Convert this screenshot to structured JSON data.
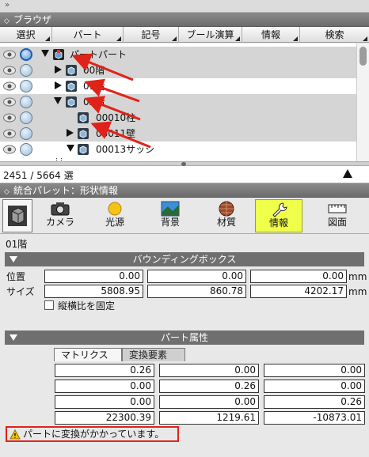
{
  "top_strip": "»",
  "browser": {
    "title": "ブラウザ",
    "menu": [
      "選択",
      "パート",
      "記号",
      "ブール演算",
      "情報",
      "検索"
    ],
    "tree": [
      {
        "label": "パートパート",
        "expanded": true
      },
      {
        "label": "00階",
        "expanded": false
      },
      {
        "label": "01階",
        "expanded": false
      },
      {
        "label": "02階",
        "expanded": true
      },
      {
        "label": "00010柱"
      },
      {
        "label": "00011壁",
        "expanded": false
      },
      {
        "label": "00013サッシ",
        "expanded": true
      }
    ],
    "status_count": "2451 / 5664 選"
  },
  "palette": {
    "title": "統合パレット：形状情報",
    "tabs": [
      {
        "label": "カメラ",
        "icon": "camera-icon"
      },
      {
        "label": "光源",
        "icon": "light-sun-icon"
      },
      {
        "label": "背景",
        "icon": "background-icon"
      },
      {
        "label": "材質",
        "icon": "material-sphere-icon"
      },
      {
        "label": "情報",
        "icon": "wrench-icon"
      },
      {
        "label": "図面",
        "icon": "drawing-ruler-icon"
      }
    ],
    "active_tab": "情報",
    "object_name": "01階",
    "bbox": {
      "title": "バウンディングボックス",
      "position_label": "位置",
      "size_label": "サイズ",
      "position": [
        "0.00",
        "0.00",
        "0.00"
      ],
      "size": [
        "5808.95",
        "860.78",
        "4202.17"
      ],
      "unit": "mm",
      "keep_ratio_label": "縦横比を固定"
    },
    "part": {
      "title": "パート属性",
      "subtabs": [
        "マトリクス",
        "変換要素"
      ],
      "matrix": [
        [
          "0.26",
          "0.00",
          "0.00"
        ],
        [
          "0.00",
          "0.26",
          "0.00"
        ],
        [
          "0.00",
          "0.00",
          "0.26"
        ],
        [
          "22300.39",
          "1219.61",
          "-10873.01"
        ]
      ]
    },
    "warning": "パートに変換がかかっています。"
  },
  "colors": {
    "annotation": "#e0231a",
    "active_tab": "#efff4a"
  }
}
